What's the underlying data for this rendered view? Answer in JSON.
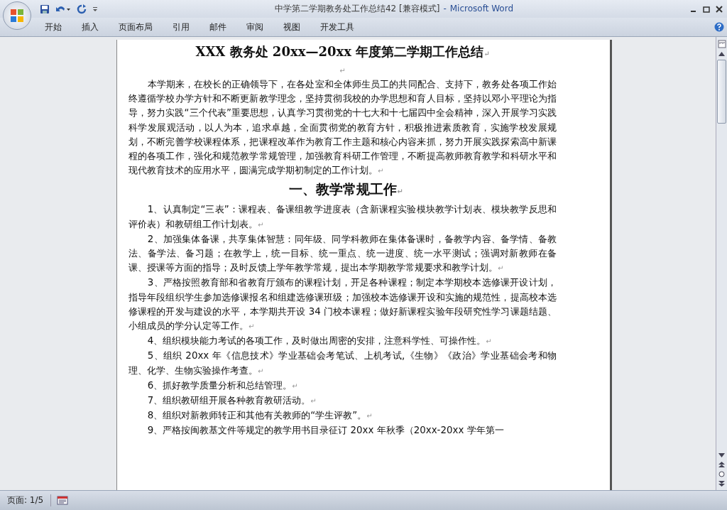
{
  "window": {
    "title": "中学第二学期教务处工作总结42 [兼容模式]",
    "separator": "-",
    "app_name": "Microsoft Word"
  },
  "ribbon_tabs": [
    "开始",
    "插入",
    "页面布局",
    "引用",
    "邮件",
    "审阅",
    "视图",
    "开发工具"
  ],
  "document": {
    "paragraphs": [
      {
        "kind": "title",
        "text": "XXX 教务处 20xx—20xx 年度第二学期工作总结",
        "mark": "↵"
      },
      {
        "kind": "blank",
        "mark": "↵"
      },
      {
        "kind": "body",
        "text": "本学期来，在校长的正确领导下，在各处室和全体师生员工的共同配合、支持下，教务处各项工作始终遵循学校办学方针和不断更新教学理念，坚持贯彻我校的办学思想和育人目标，坚持以邓小平理论为指导，努力实践“三个代表”重要思想，认真学习贯彻党的十七大和十七届四中全会精神，深入开展学习实践科学发展观活动，以人为本，追求卓越，全面贯彻党的教育方针，积极推进素质教育，实施学校发展规划，不断完善学校课程体系，把课程改革作为教育工作主题和核心内容来抓，努力开展实践探索高中新课程的各项工作，强化和规范教学常规管理，加强教育科研工作管理，不断提高教师教育教学和科研水平和现代教育技术的应用水平，圆满完成学期初制定的工作计划。",
        "mark": "↵"
      },
      {
        "kind": "heading",
        "text": "一、教学常规工作",
        "mark": "↵"
      },
      {
        "kind": "body",
        "text": "1、认真制定“三表”：课程表、备课组教学进度表（含新课程实验模块教学计划表、模块教学反思和评价表）和教研组工作计划表。",
        "mark": "↵"
      },
      {
        "kind": "body",
        "text": "2、加强集体备课，共享集体智慧：同年级、同学科教师在集体备课时，备教学内容、备学情、备教法、备学法、备习题；在教学上，统一目标、统一重点、统一进度、统一水平测试；强调对新教师在备课、授课等方面的指导；及时反馈上学年教学常规，提出本学期教学常规要求和教学计划。",
        "mark": "↵"
      },
      {
        "kind": "body",
        "text": "3、严格按照教育部和省教育厅颁布的课程计划，开足各种课程；制定本学期校本选修课开设计划，指导年段组织学生参加选修课报名和组建选修课班级；加强校本选修课开设和实施的规范性，提高校本选修课程的开发与建设的水平，本学期共开设 34 门校本课程；做好新课程实验年段研究性学习课题结题、小组成员的学分认定等工作。",
        "mark": "↵"
      },
      {
        "kind": "body",
        "text": "4、组织模块能力考试的各项工作，及时做出周密的安排，注意科学性、可操作性。",
        "mark": "↵"
      },
      {
        "kind": "body",
        "text": "5、组织 20xx 年《信息技术》学业基础会考笔试、上机考试,《生物》《政治》学业基础会考和物理、化学、生物实验操作考查。",
        "mark": "↵"
      },
      {
        "kind": "body",
        "text": "6、抓好教学质量分析和总结管理。",
        "mark": "↵"
      },
      {
        "kind": "body",
        "text": "7、组织教研组开展各种教育教研活动。",
        "mark": "↵"
      },
      {
        "kind": "body",
        "text": "8、组织对新教师转正和其他有关教师的“学生评教”。",
        "mark": "↵"
      },
      {
        "kind": "body",
        "text": "9、严格按闽教基文件等规定的教学用书目录征订 20xx 年秋季（20xx-20xx 学年第一"
      }
    ]
  },
  "status_bar": {
    "page": "页面: 1/5"
  }
}
